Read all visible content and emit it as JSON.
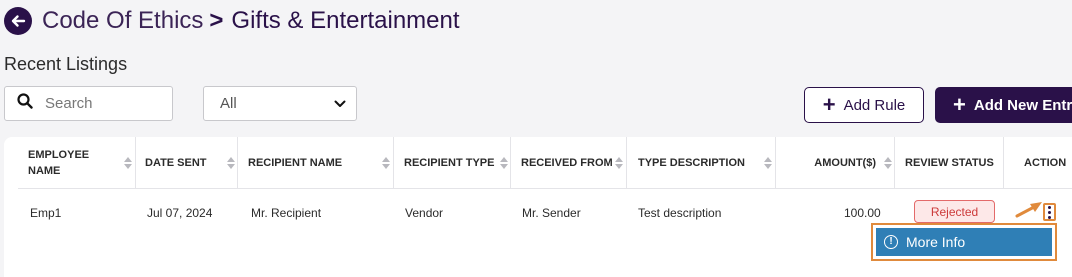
{
  "breadcrumb": {
    "parent": "Code Of Ethics",
    "separator": ">",
    "current": "Gifts & Entertainment"
  },
  "section_title": "Recent Listings",
  "search": {
    "placeholder": "Search",
    "value": ""
  },
  "filter": {
    "selected": "All"
  },
  "buttons": {
    "add_rule": "Add Rule",
    "add_new_entry": "Add New Entry"
  },
  "table": {
    "headers": [
      "EMPLOYEE NAME",
      "DATE SENT",
      "RECIPIENT NAME",
      "RECIPIENT TYPE",
      "RECEIVED FROM",
      "TYPE DESCRIPTION",
      "AMOUNT($)",
      "REVIEW STATUS",
      "ACTION"
    ],
    "rows": [
      {
        "employee": "Emp1",
        "date_sent": "Jul 07, 2024",
        "recipient_name": "Mr. Recipient",
        "recipient_type": "Vendor",
        "received_from": "Mr. Sender",
        "type_description": "Test description",
        "amount": "100.00",
        "status": "Rejected"
      }
    ]
  },
  "action_menu": {
    "item": "More Info"
  },
  "colors": {
    "brand": "#2a1149",
    "highlight": "#e08a3c",
    "menu_item": "#2f7fb6",
    "rejected": "#cc3a3a"
  }
}
